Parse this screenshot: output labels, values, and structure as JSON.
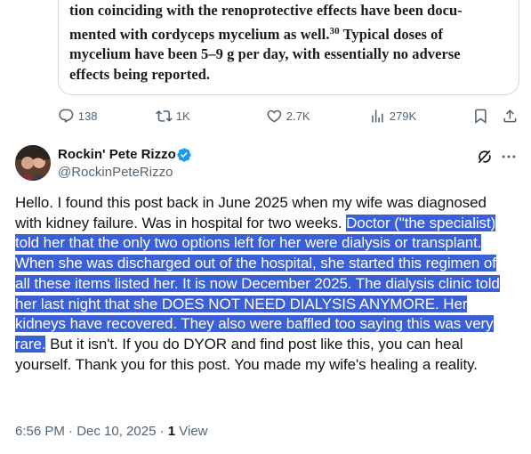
{
  "quoted_card": {
    "lines": [
      "tion coinciding with the renoprotective effects have been docu-",
      "mented with cordyceps mycelium as well.",
      "30",
      " Typical doses of",
      "mycelium have been 5–9 g per day, with essentially no adverse",
      "effects being reported."
    ]
  },
  "actions": {
    "replies": "138",
    "reposts": "1K",
    "likes": "2.7K",
    "views": "279K",
    "icons": [
      "reply-icon",
      "repost-icon",
      "like-icon",
      "views-icon",
      "bookmark-icon",
      "share-icon"
    ]
  },
  "reply": {
    "display_name": "Rockin' Pete Rizzo",
    "handle": "@RockinPeteRizzo",
    "verified_color": "#1d9bf0",
    "text_before": "Hello. I found this post back in June 2025 when my wife was diagnosed with kidney failure. Was in hospital for two weeks. ",
    "text_highlighted": "Doctor (\"the specialist) told her that the only two options left for her were dialysis or transplant. When she was discharged out of the hospital, she started this regimen of all these items listed her. It is now December 2025. The dialysis clinic told her last night that she DOES NOT NEED DIALYSIS ANYMORE. Her kidneys have recovered. They also were baffled too saying this was very rare.",
    "text_after": " But it isn't. If you do DYOR and find post like this, you can heal yourself. Thank you for this post. You made my wife's healing a reality.",
    "timestamp": "6:56 PM · Dec 10, 2025 · ",
    "views_count": "1",
    "views_label": " View"
  },
  "colors": {
    "selection": "#3b5fd6",
    "muted": "#536471",
    "text": "#0f1419"
  }
}
